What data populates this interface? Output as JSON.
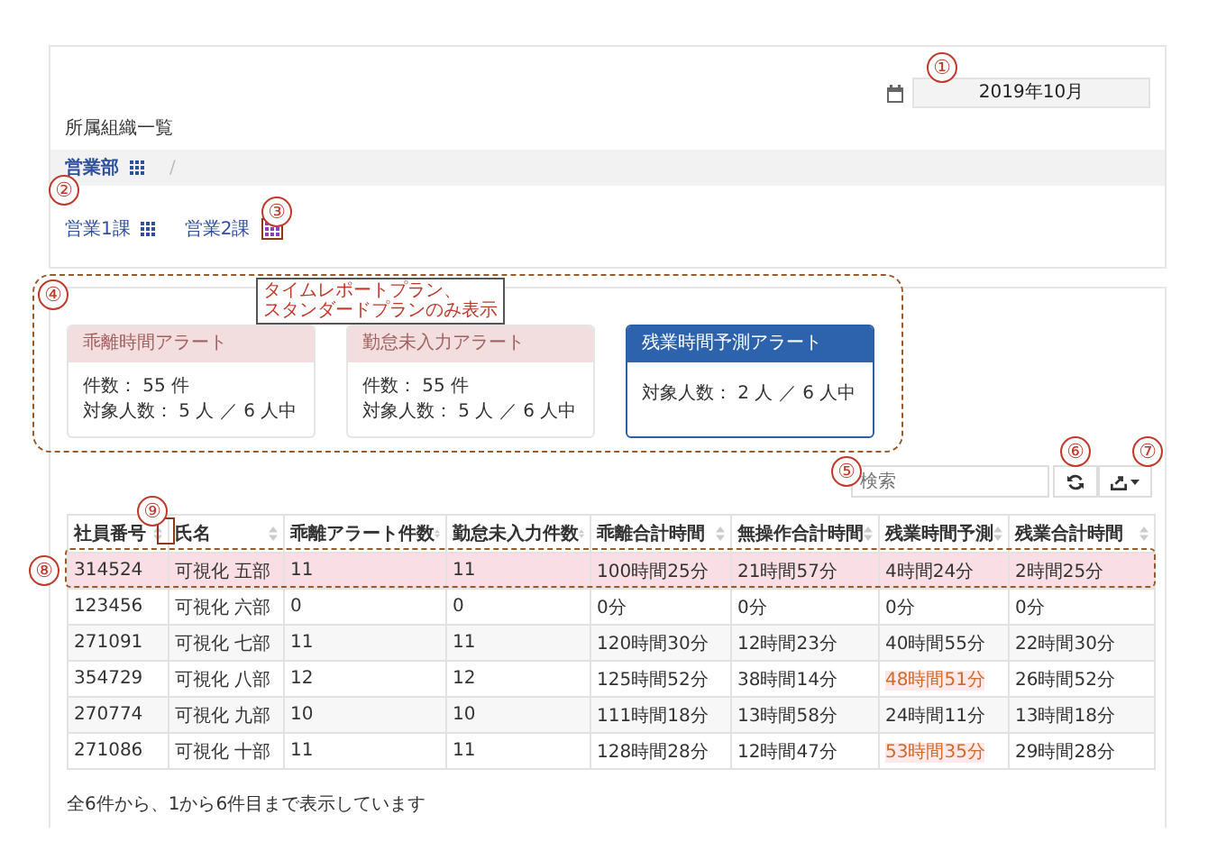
{
  "date_field": {
    "value": "2019年10月"
  },
  "org_panel": {
    "title": "所属組織一覧",
    "breadcrumb": [
      "営業部",
      "/"
    ],
    "units": [
      {
        "label": "営業1課",
        "highlighted": false
      },
      {
        "label": "営業2課",
        "highlighted": true
      }
    ]
  },
  "note": [
    "タイムレポートプラン、",
    "スタンダードプランのみ表示"
  ],
  "alerts": [
    {
      "title": "乖離時間アラート",
      "selected": false,
      "lines": [
        "件数： 55 件",
        "対象人数： 5 人 ／ 6 人中"
      ]
    },
    {
      "title": "勤怠未入力アラート",
      "selected": false,
      "lines": [
        "件数： 55 件",
        "対象人数： 5 人 ／ 6 人中"
      ]
    },
    {
      "title": "残業時間予測アラート",
      "selected": true,
      "lines": [
        "対象人数： 2 人 ／ 6 人中"
      ]
    }
  ],
  "search": {
    "placeholder": "検索"
  },
  "table": {
    "columns": [
      "社員番号",
      "氏名",
      "乖離アラート件数",
      "勤怠未入力件数",
      "乖離合計時間",
      "無操作合計時間",
      "残業時間予測",
      "残業合計時間"
    ],
    "rows": [
      {
        "highlighted": true,
        "cells": [
          {
            "text": "314524",
            "alert": false
          },
          {
            "text": "可視化 五部",
            "alert": false
          },
          {
            "text": "11",
            "alert": false
          },
          {
            "text": "11",
            "alert": false
          },
          {
            "text": "100時間25分",
            "alert": false
          },
          {
            "text": "21時間57分",
            "alert": false
          },
          {
            "text": "4時間24分",
            "alert": false
          },
          {
            "text": "2時間25分",
            "alert": false
          }
        ]
      },
      {
        "highlighted": false,
        "cells": [
          {
            "text": "123456",
            "alert": false
          },
          {
            "text": "可視化 六部",
            "alert": false
          },
          {
            "text": "0",
            "alert": false
          },
          {
            "text": "0",
            "alert": false
          },
          {
            "text": "0分",
            "alert": false
          },
          {
            "text": "0分",
            "alert": false
          },
          {
            "text": "0分",
            "alert": false
          },
          {
            "text": "0分",
            "alert": false
          }
        ]
      },
      {
        "highlighted": false,
        "cells": [
          {
            "text": "271091",
            "alert": false
          },
          {
            "text": "可視化 七部",
            "alert": false
          },
          {
            "text": "11",
            "alert": false
          },
          {
            "text": "11",
            "alert": false
          },
          {
            "text": "120時間30分",
            "alert": false
          },
          {
            "text": "12時間23分",
            "alert": false
          },
          {
            "text": "40時間55分",
            "alert": false
          },
          {
            "text": "22時間30分",
            "alert": false
          }
        ]
      },
      {
        "highlighted": false,
        "cells": [
          {
            "text": "354729",
            "alert": false
          },
          {
            "text": "可視化 八部",
            "alert": false
          },
          {
            "text": "12",
            "alert": false
          },
          {
            "text": "12",
            "alert": false
          },
          {
            "text": "125時間52分",
            "alert": false
          },
          {
            "text": "38時間14分",
            "alert": false
          },
          {
            "text": "48時間51分",
            "alert": true
          },
          {
            "text": "26時間52分",
            "alert": false
          }
        ]
      },
      {
        "highlighted": false,
        "cells": [
          {
            "text": "270774",
            "alert": false
          },
          {
            "text": "可視化 九部",
            "alert": false
          },
          {
            "text": "10",
            "alert": false
          },
          {
            "text": "10",
            "alert": false
          },
          {
            "text": "111時間18分",
            "alert": false
          },
          {
            "text": "13時間58分",
            "alert": false
          },
          {
            "text": "24時間11分",
            "alert": false
          },
          {
            "text": "13時間18分",
            "alert": false
          }
        ]
      },
      {
        "highlighted": false,
        "cells": [
          {
            "text": "271086",
            "alert": false
          },
          {
            "text": "可視化 十部",
            "alert": false
          },
          {
            "text": "11",
            "alert": false
          },
          {
            "text": "11",
            "alert": false
          },
          {
            "text": "128時間28分",
            "alert": false
          },
          {
            "text": "12時間47分",
            "alert": false
          },
          {
            "text": "53時間35分",
            "alert": true
          },
          {
            "text": "29時間28分",
            "alert": false
          }
        ]
      }
    ],
    "footer": "全6件から、1から6件目まで表示しています"
  },
  "callouts": [
    "①",
    "②",
    "③",
    "④",
    "⑤",
    "⑥",
    "⑦",
    "⑧",
    "⑨"
  ]
}
